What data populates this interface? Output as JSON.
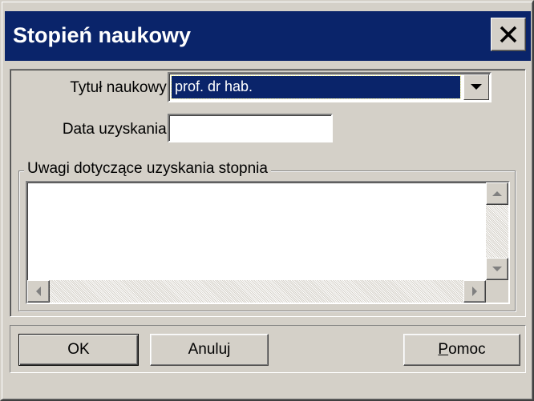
{
  "window": {
    "title": "Stopień naukowy",
    "close_icon": "close-icon"
  },
  "form": {
    "tytul_label": "Tytuł naukowy:",
    "tytul_value": "prof. dr hab.",
    "data_label": "Data uzyskania:",
    "data_value": ""
  },
  "notes": {
    "group_title": "Uwagi dotyczące uzyskania stopnia",
    "text": ""
  },
  "buttons": {
    "ok": "OK",
    "cancel": "Anuluj",
    "help_first": "P",
    "help_rest": "omoc"
  },
  "colors": {
    "titlebar": "#0a246a",
    "face": "#d4d0c8",
    "selection": "#0a246a"
  }
}
